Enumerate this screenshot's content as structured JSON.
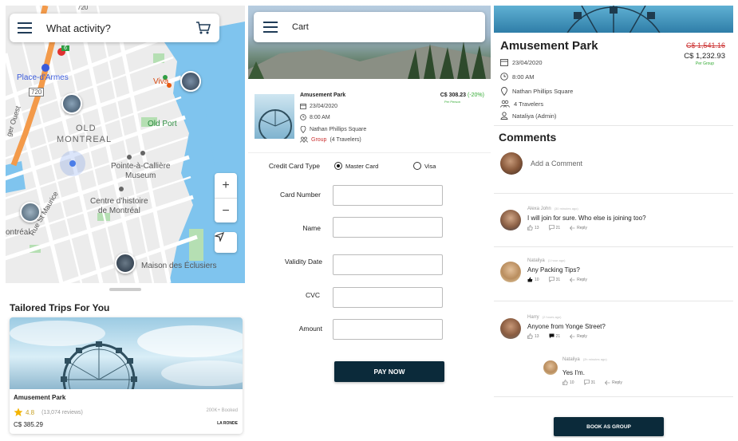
{
  "screen1": {
    "search_placeholder": "What activity?",
    "map_labels": {
      "place_darmes": "Place-d'Armes",
      "old_montreal_1": "OLD",
      "old_montreal_2": "MONTREAL",
      "viva": "Viva",
      "old_port": "Old Port",
      "pointe_1": "Pointe-à-Callière",
      "pointe_2": "Museum",
      "centre_1": "Centre d'histoire",
      "centre_2": "de Montréal",
      "ontreal": "ontréal",
      "rue_st_maurice": "Rue St Maurice",
      "maison": "Maison des Éclusiers",
      "route_720a": "720",
      "route_720b": "720",
      "route_6": "6",
      "ger_ouest": "ger Ouest"
    },
    "zoom_in": "+",
    "zoom_out": "−",
    "section_title": "Tailored Trips For You",
    "trip": {
      "name": "Amusement Park",
      "rating": "4.8",
      "reviews": "(13,074 reviews)",
      "booked": "200K+ Booked",
      "price": "C$ 385.29",
      "brand": "LA RONDE"
    }
  },
  "screen2": {
    "title": "Cart",
    "item": {
      "name": "Amusement Park",
      "date": "23/04/2020",
      "time": "8:00 AM",
      "location": "Nathan Phillips Square",
      "group_label": "Group",
      "travelers": "(4 Travelers)",
      "price": "C$ 308.23",
      "discount": "(-20%)",
      "per": "Per Person"
    },
    "form": {
      "card_type_label": "Credit Card Type",
      "option_master": "Master Card",
      "option_visa": "Visa",
      "card_number": "Card Number",
      "name": "Name",
      "validity": "Validity Date",
      "cvc": "CVC",
      "amount": "Amount"
    },
    "pay_button": "PAY NOW"
  },
  "screen3": {
    "title": "Amusement Park",
    "old_price": "C$ 1,541.16",
    "new_price": "C$ 1,232.93",
    "per_group": "Per Group",
    "date": "23/04/2020",
    "time": "8:00 AM",
    "location": "Nathan Phillips Square",
    "travelers": "4 Travelers",
    "admin": "Nataliya (Admin)",
    "comments_title": "Comments",
    "add_comment": "Add a Comment",
    "comments": [
      {
        "name": "Alexa John",
        "time": "(30 minutes ago)",
        "text": "I will join for sure. Who else is joining too?",
        "likes": "13",
        "replies": "21",
        "reply": "Reply"
      },
      {
        "name": "Nataliya",
        "time": "(1 hour ago)",
        "text": "Any Packing Tips?",
        "likes": "10",
        "replies": "31",
        "reply": "Reply"
      },
      {
        "name": "Harry",
        "time": "(2 hours ago)",
        "text": "Anyone from Yonge Street?",
        "likes": "13",
        "replies": "21",
        "reply": "Reply"
      },
      {
        "name": "Nataliya",
        "time": "(2h minutes ago)",
        "text": "Yes I'm.",
        "likes": "10",
        "replies": "31",
        "reply": "Reply"
      }
    ],
    "book_button": "BOOK AS GROUP"
  },
  "colors": {
    "primary_dark": "#0b2a3a",
    "accent_green": "#33aa33",
    "accent_red": "#cc3333",
    "water": "#7fc4ee",
    "star": "#f4b400"
  }
}
